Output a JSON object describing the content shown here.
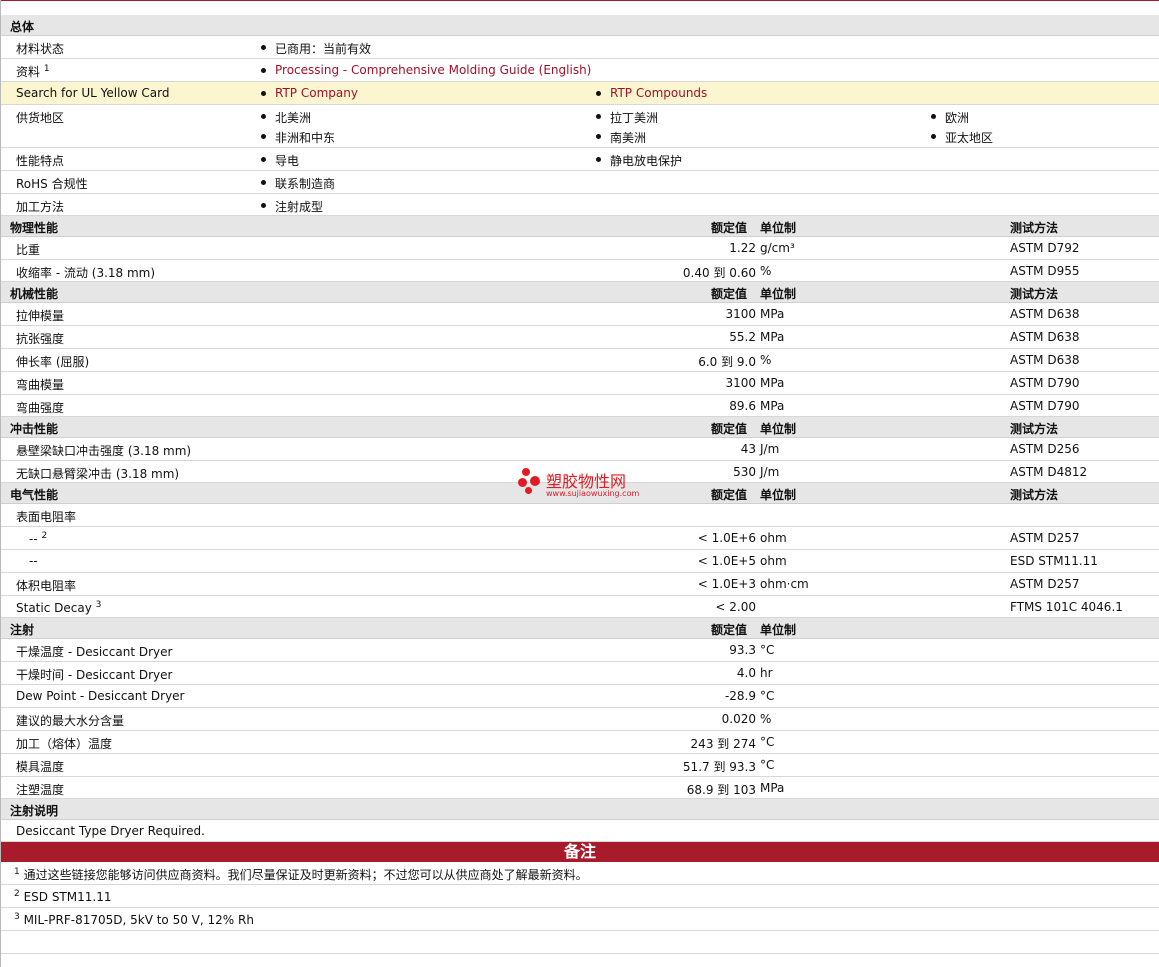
{
  "general": {
    "title": "总体",
    "material_status_label": "材料状态",
    "material_status_value": "已商用：当前有效",
    "docs_label": "资料",
    "docs_sup": "1",
    "docs_link": "Processing - Comprehensive Molding Guide (English)",
    "ul_label": "Search for UL Yellow Card",
    "ul_link1": "RTP Company",
    "ul_link2": "RTP Compounds",
    "regions_label": "供货地区",
    "regions": [
      "北美洲",
      "拉丁美洲",
      "欧洲",
      "非洲和中东",
      "南美洲",
      "亚太地区"
    ],
    "features_label": "性能特点",
    "features": [
      "导电",
      "静电放电保护"
    ],
    "rohs_label": "RoHS 合规性",
    "rohs_value": "联系制造商",
    "processing_label": "加工方法",
    "processing_value": "注射成型"
  },
  "headers": {
    "nominal": "额定值",
    "unit": "单位制",
    "method": "测试方法"
  },
  "physical": {
    "title": "物理性能",
    "rows": [
      {
        "name": "比重",
        "value": "1.22",
        "unit": "g/cm³",
        "method": "ASTM D792"
      },
      {
        "name": "收缩率  - 流动  (3.18 mm)",
        "value": "0.40 到  0.60",
        "unit": "%",
        "method": "ASTM D955"
      }
    ]
  },
  "mechanical": {
    "title": "机械性能",
    "rows": [
      {
        "name": "拉伸模量",
        "value": "3100",
        "unit": "MPa",
        "method": "ASTM D638"
      },
      {
        "name": "抗张强度",
        "value": "55.2",
        "unit": "MPa",
        "method": "ASTM D638"
      },
      {
        "name": "伸长率  (屈服)",
        "value": "6.0 到  9.0",
        "unit": "%",
        "method": "ASTM D638"
      },
      {
        "name": "弯曲模量",
        "value": "3100",
        "unit": "MPa",
        "method": "ASTM D790"
      },
      {
        "name": "弯曲强度",
        "value": "89.6",
        "unit": "MPa",
        "method": "ASTM D790"
      }
    ]
  },
  "impact": {
    "title": "冲击性能",
    "rows": [
      {
        "name": "悬壁梁缺口冲击强度  (3.18 mm)",
        "value": "43",
        "unit": "J/m",
        "method": "ASTM D256"
      },
      {
        "name": "无缺口悬臂梁冲击  (3.18 mm)",
        "value": "530",
        "unit": "J/m",
        "method": "ASTM D4812"
      }
    ]
  },
  "electrical": {
    "title": "电气性能",
    "surface_label": "表面电阻率",
    "rows": [
      {
        "name": "--",
        "sup": "2",
        "value": "< 1.0E+6",
        "unit": "ohm",
        "method": "ASTM D257"
      },
      {
        "name": "--",
        "sup": "",
        "value": "< 1.0E+5",
        "unit": "ohm",
        "method": "ESD STM11.11"
      },
      {
        "name": "体积电阻率",
        "sup": "",
        "value": "< 1.0E+3",
        "unit": "ohm·cm",
        "method": "ASTM D257"
      },
      {
        "name": "Static Decay",
        "sup": "3",
        "value": "< 2.00",
        "unit": "",
        "method": "FTMS 101C 4046.1"
      }
    ]
  },
  "injection": {
    "title": "注射",
    "rows": [
      {
        "name": "干燥温度  - Desiccant Dryer",
        "value": "93.3",
        "unit": "°C"
      },
      {
        "name": "干燥时间  - Desiccant Dryer",
        "value": "4.0",
        "unit": "hr"
      },
      {
        "name": "Dew Point - Desiccant Dryer",
        "value": "-28.9",
        "unit": "°C"
      },
      {
        "name": "建议的最大水分含量",
        "value": "0.020",
        "unit": "%"
      },
      {
        "name": "加工（熔体）温度",
        "value": "243 到  274",
        "unit": "°C"
      },
      {
        "name": "模具温度",
        "value": "51.7 到  93.3",
        "unit": "°C"
      },
      {
        "name": "注塑温度",
        "value": "68.9 到  103",
        "unit": "MPa"
      }
    ]
  },
  "injection_notes": {
    "title": "注射说明",
    "text": "Desiccant Type Dryer Required."
  },
  "notes": {
    "title": "备注",
    "items": [
      {
        "sup": "1",
        "text": "通过这些链接您能够访问供应商资料。我们尽量保证及时更新资料；不过您可以从供应商处了解最新资料。"
      },
      {
        "sup": "2",
        "text": "ESD STM11.11"
      },
      {
        "sup": "3",
        "text": "MIL-PRF-81705D, 5kV to 50 V, 12% Rh"
      }
    ]
  },
  "watermark": {
    "title": "塑胶物性网",
    "url": "www.sujiaowuxing.com"
  },
  "colors": {
    "accent": "#a81b2a",
    "link": "#a0112b",
    "section_bg": "#e6e6e6",
    "highlight_bg": "#fbf6cf"
  }
}
